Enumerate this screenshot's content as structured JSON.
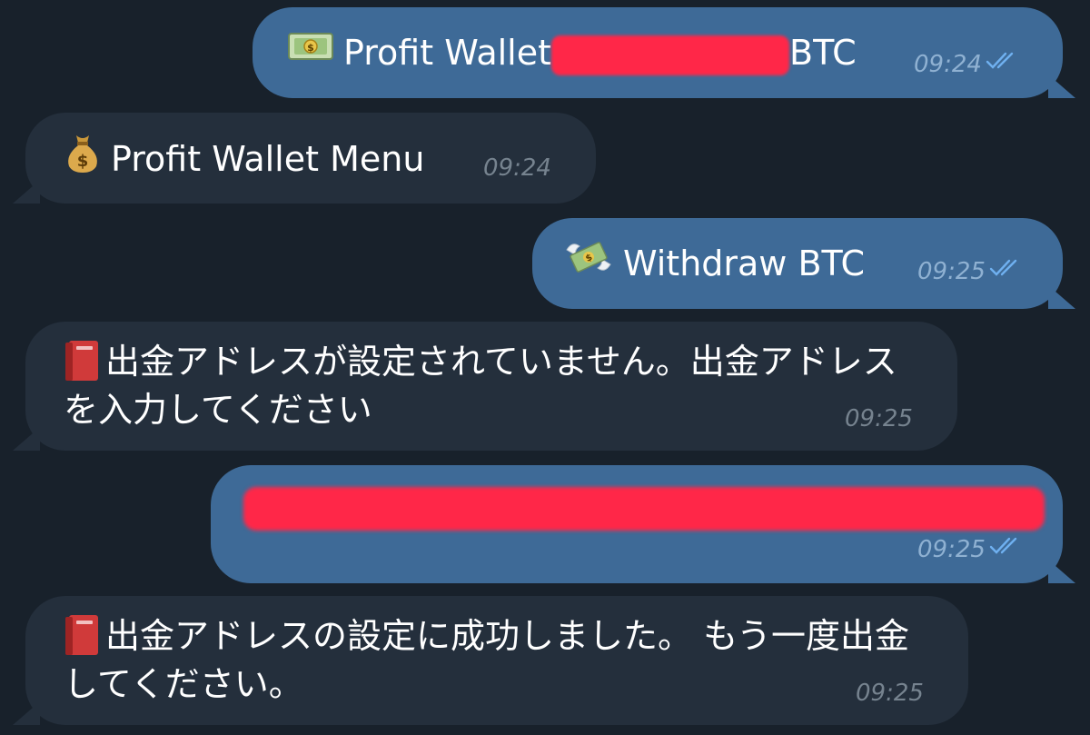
{
  "messages": [
    {
      "direction": "outgoing",
      "icon": "dollar-banknote-icon",
      "text_before": "Profit Wallet",
      "text_after": "BTC",
      "has_redaction": true,
      "time": "09:24",
      "status": "read"
    },
    {
      "direction": "incoming",
      "icon": "money-bag-icon",
      "text": "Profit Wallet Menu",
      "time": "09:24"
    },
    {
      "direction": "outgoing",
      "icon": "money-with-wings-icon",
      "text": "Withdraw BTC",
      "time": "09:25",
      "status": "read"
    },
    {
      "direction": "incoming",
      "icon": "red-book-icon",
      "text": "出金アドレスが設定されていません。出金アドレスを入力してください",
      "time": "09:25"
    },
    {
      "direction": "outgoing",
      "text": "",
      "has_redaction": true,
      "time": "09:25",
      "status": "read"
    },
    {
      "direction": "incoming",
      "icon": "red-book-icon",
      "text": "出金アドレスの設定に成功しました。 もう一度出金してください。",
      "time": "09:25"
    }
  ],
  "colors": {
    "background": "#18212b",
    "outgoing_bubble": "#3e6a97",
    "incoming_bubble": "#242f3c",
    "redaction": "#ff2748",
    "read_check": "#6fb0f0"
  }
}
